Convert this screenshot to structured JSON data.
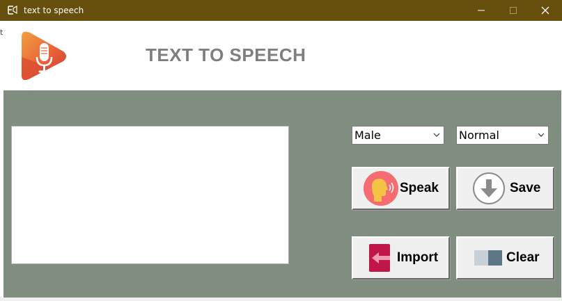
{
  "window": {
    "title": "text to speech"
  },
  "side_glyph": "t",
  "header": {
    "title": "TEXT TO SPEECH"
  },
  "input": {
    "text": ""
  },
  "options": {
    "gender": "Male",
    "speed": "Normal"
  },
  "buttons": {
    "speak": "Speak",
    "save": "Save",
    "import": "Import",
    "clear": "Clear"
  },
  "colors": {
    "titlebar": "#664f0d",
    "panel": "#7f8e7f",
    "header_text": "#7f7f7f",
    "button_face": "#f0f0f0"
  },
  "icons": {
    "app": "feather-pen-icon",
    "logo": "microphone-play-logo",
    "speak": "speaking-head-icon",
    "save": "download-arrow-icon",
    "import": "import-arrow-icon",
    "clear": "eraser-icon"
  }
}
